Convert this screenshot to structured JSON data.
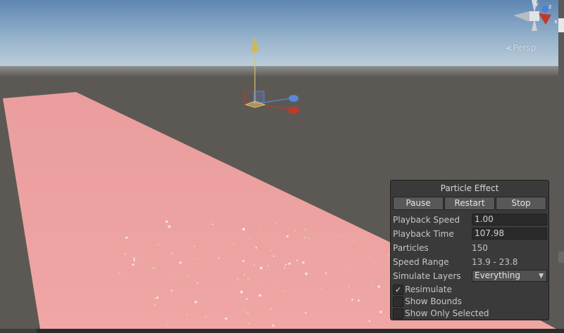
{
  "scene_view": {
    "projection_label": "Persp",
    "gizmo_axes": [
      "y",
      "z",
      "x"
    ],
    "colors": {
      "sky_top": "#5e86b2",
      "horizon": "#bccdd8",
      "ground": "#5c5954",
      "plane": "#eea4a3",
      "y_axis": "#d8c468",
      "z_axis": "#5a86d8",
      "x_axis": "#c0392b"
    }
  },
  "particle_effect": {
    "title": "Particle Effect",
    "buttons": {
      "pause": "Pause",
      "restart": "Restart",
      "stop": "Stop"
    },
    "playback_speed": {
      "label": "Playback Speed",
      "value": "1.00"
    },
    "playback_time": {
      "label": "Playback Time",
      "value": "107.98"
    },
    "particles": {
      "label": "Particles",
      "value": "150"
    },
    "speed_range": {
      "label": "Speed Range",
      "value": "13.9 - 23.8"
    },
    "simulate_layers": {
      "label": "Simulate Layers",
      "value": "Everything"
    },
    "resimulate": {
      "label": "Resimulate",
      "checked": true
    },
    "show_bounds": {
      "label": "Show Bounds",
      "checked": false
    },
    "show_only_selected": {
      "label": "Show Only Selected",
      "checked": false
    }
  }
}
